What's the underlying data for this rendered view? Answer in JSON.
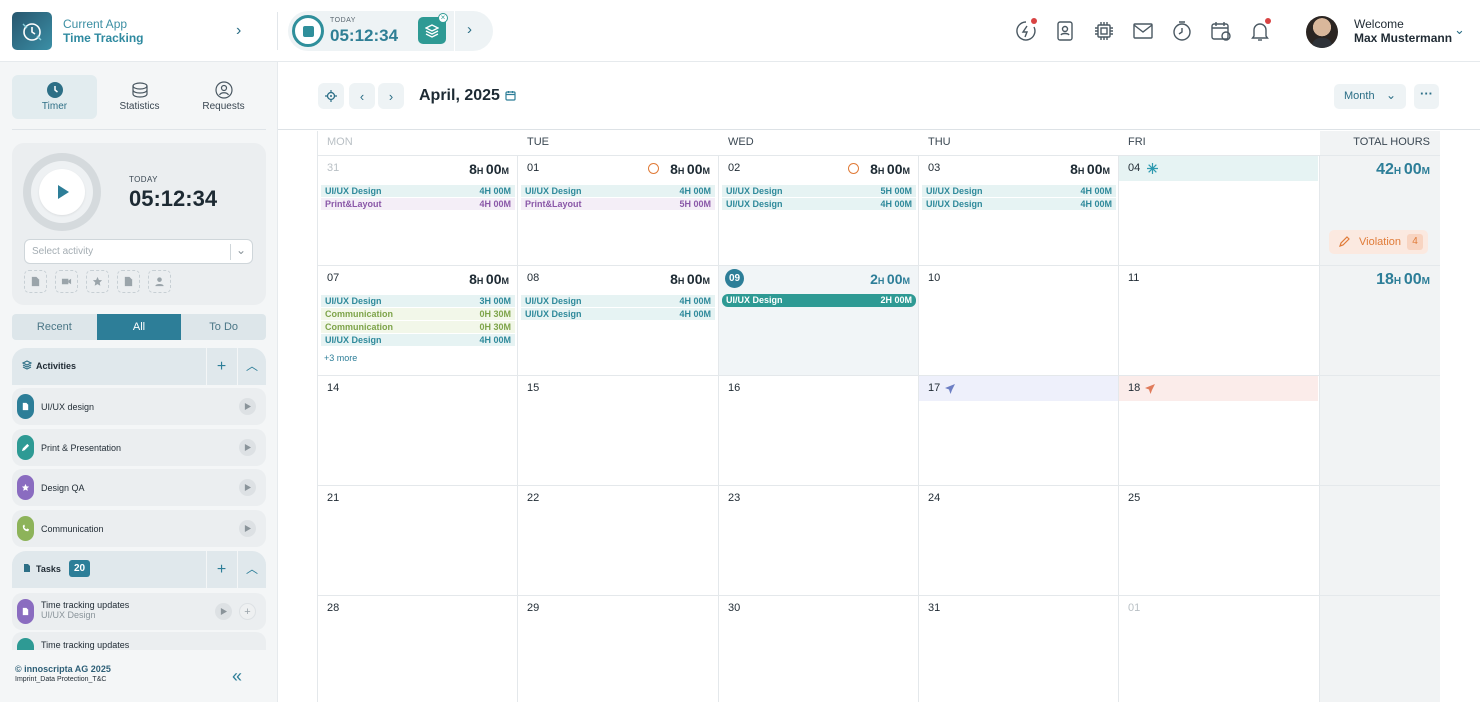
{
  "header": {
    "app_caption": "Current App",
    "app_name": "Time Tracking",
    "timer_label": "TODAY",
    "timer_value": "05:12:34",
    "welcome": "Welcome",
    "user_name": "Max Mustermann",
    "icons": [
      "lightning-chat-icon",
      "contacts-icon",
      "chip-icon",
      "mail-icon",
      "clock-icon",
      "calendar-clock-icon",
      "bell-icon"
    ]
  },
  "sidebar": {
    "tabs": [
      {
        "label": "Timer",
        "icon": "clock-icon"
      },
      {
        "label": "Statistics",
        "icon": "database-icon"
      },
      {
        "label": "Requests",
        "icon": "user-icon"
      }
    ],
    "timer": {
      "label": "TODAY",
      "value": "05:12:34",
      "placeholder": "Select activity"
    },
    "segments": [
      "Recent",
      "All",
      "To Do"
    ],
    "activities_title": "Activities",
    "activities": [
      {
        "label": "UI/UX design",
        "color": "#2d7e98"
      },
      {
        "label": "Print & Presentation",
        "color": "#2e9a94"
      },
      {
        "label": "Design QA",
        "color": "#8a6cc0"
      },
      {
        "label": "Communication",
        "color": "#8db35a"
      }
    ],
    "tasks_title": "Tasks",
    "tasks_count": "20",
    "tasks": [
      {
        "title": "Time tracking updates",
        "sub": "UI/UX Design"
      },
      {
        "title": "Time tracking updates",
        "sub": ""
      }
    ],
    "footer_copyright": "© innoscripta AG 2025",
    "footer_links": "Imprint_Data Protection_T&C"
  },
  "calendar": {
    "title": "April, 2025",
    "view": "Month",
    "columns": [
      "MON",
      "TUE",
      "WED",
      "THU",
      "FRI",
      "TOTAL HOURS"
    ],
    "weeks": [
      {
        "total": {
          "h": "42",
          "m": "00"
        },
        "violation": {
          "label": "Violation",
          "count": "4"
        },
        "days": [
          {
            "num": "31",
            "muted": true,
            "hours": {
              "h": "8",
              "m": "00"
            },
            "entries": [
              {
                "name": "UI/UX Design",
                "h": "4",
                "m": "00",
                "kind": "ux"
              },
              {
                "name": "Print&Layout",
                "h": "4",
                "m": "00",
                "kind": "print"
              }
            ]
          },
          {
            "num": "01",
            "warn": true,
            "hours": {
              "h": "8",
              "m": "00"
            },
            "entries": [
              {
                "name": "UI/UX Design",
                "h": "4",
                "m": "00",
                "kind": "ux"
              },
              {
                "name": "Print&Layout",
                "h": "5",
                "m": "00",
                "kind": "print"
              }
            ]
          },
          {
            "num": "02",
            "warn": true,
            "hours": {
              "h": "8",
              "m": "00"
            },
            "entries": [
              {
                "name": "UI/UX Design",
                "h": "5",
                "m": "00",
                "kind": "ux"
              },
              {
                "name": "UI/UX Design",
                "h": "4",
                "m": "00",
                "kind": "ux"
              }
            ]
          },
          {
            "num": "03",
            "hours": {
              "h": "8",
              "m": "00"
            },
            "entries": [
              {
                "name": "UI/UX Design",
                "h": "4",
                "m": "00",
                "kind": "ux"
              },
              {
                "name": "UI/UX Design",
                "h": "4",
                "m": "00",
                "kind": "ux"
              }
            ]
          },
          {
            "num": "04",
            "holiday": "snowflake-icon",
            "strip": "#e6f3f3",
            "entries": []
          }
        ]
      },
      {
        "total": {
          "h": "18",
          "m": "00"
        },
        "days": [
          {
            "num": "07",
            "hours": {
              "h": "8",
              "m": "00"
            },
            "more": "+3 more",
            "entries": [
              {
                "name": "UI/UX Design",
                "h": "3",
                "m": "00",
                "kind": "ux"
              },
              {
                "name": "Communication",
                "h": "0",
                "m": "30",
                "kind": "comm"
              },
              {
                "name": "Communication",
                "h": "0",
                "m": "30",
                "kind": "comm"
              },
              {
                "name": "UI/UX Design",
                "h": "4",
                "m": "00",
                "kind": "ux"
              }
            ]
          },
          {
            "num": "08",
            "hours": {
              "h": "8",
              "m": "00"
            },
            "entries": [
              {
                "name": "UI/UX Design",
                "h": "4",
                "m": "00",
                "kind": "ux"
              },
              {
                "name": "UI/UX Design",
                "h": "4",
                "m": "00",
                "kind": "ux"
              }
            ]
          },
          {
            "num": "09",
            "today": true,
            "hours": {
              "h": "2",
              "m": "00"
            },
            "entries": [
              {
                "name": "UI/UX Design",
                "h": "2",
                "m": "00",
                "kind": "bar"
              }
            ]
          },
          {
            "num": "10",
            "entries": []
          },
          {
            "num": "11",
            "entries": []
          }
        ]
      },
      {
        "days": [
          {
            "num": "14",
            "entries": []
          },
          {
            "num": "15",
            "entries": []
          },
          {
            "num": "16",
            "entries": []
          },
          {
            "num": "17",
            "holiday": "plane-icon",
            "strip": "#eef0fb",
            "iconColor": "#6d7fc4",
            "entries": []
          },
          {
            "num": "18",
            "holiday": "plane-icon",
            "strip": "#fbecea",
            "iconColor": "#e07b5b",
            "entries": []
          }
        ]
      },
      {
        "days": [
          {
            "num": "21",
            "entries": []
          },
          {
            "num": "22",
            "entries": []
          },
          {
            "num": "23",
            "entries": []
          },
          {
            "num": "24",
            "entries": []
          },
          {
            "num": "25",
            "entries": []
          }
        ]
      },
      {
        "days": [
          {
            "num": "28",
            "entries": []
          },
          {
            "num": "29",
            "entries": []
          },
          {
            "num": "30",
            "entries": []
          },
          {
            "num": "31",
            "entries": []
          },
          {
            "num": "01",
            "muted": true,
            "entries": []
          }
        ]
      }
    ]
  },
  "colors": {
    "accent": "#2d7e98",
    "teal": "#2e9a94",
    "warning": "#e07b38"
  }
}
